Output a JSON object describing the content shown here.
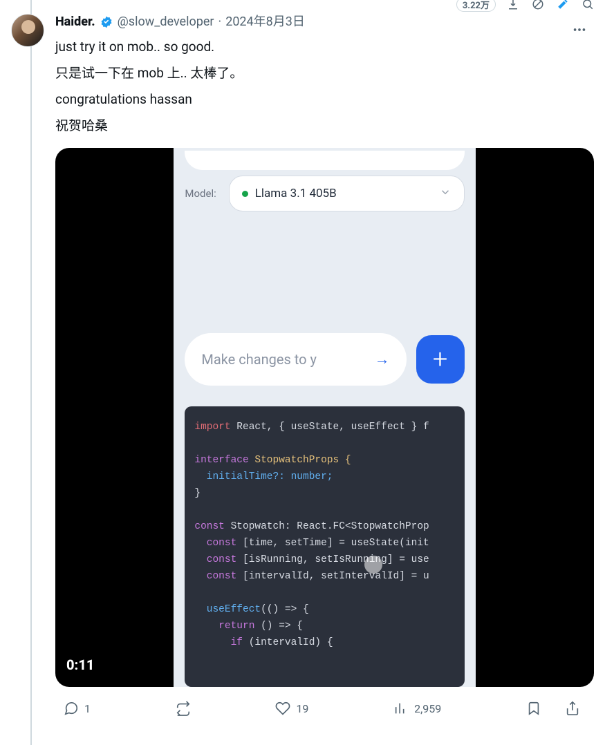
{
  "top": {
    "count_pill": "3.22万",
    "download_icon": "download-icon",
    "no_icon": "no-symbol-icon",
    "highlight_icon": "highlighter-icon",
    "search_icon": "search-icon"
  },
  "tweet": {
    "display_name": "Haider.",
    "handle": "@slow_developer",
    "dot": "·",
    "date": "2024年8月3日",
    "line1": "just try it on mob.. so good.",
    "line2": "只是试一下在 mob 上.. 太棒了。",
    "line3": "congratulations hassan",
    "line4": "祝贺哈桑"
  },
  "media": {
    "video_time": "0:11",
    "model_label": "Model:",
    "model_name": "Llama 3.1 405B",
    "input_placeholder": "Make changes to y",
    "code": {
      "l1_import": "import",
      "l1_rest": " React, { useState, useEffect } f",
      "l3_kw": "interface",
      "l3_name": " StopwatchProps {",
      "l4": "  initialTime?: number;",
      "l5": "}",
      "l7_kw": "const",
      "l7_rest": " Stopwatch: React.FC<StopwatchProp",
      "l8_kw": "  const",
      "l8_rest": " [time, setTime] = useState(init",
      "l9_kw": "  const",
      "l9_rest": " [isRunning, setIsRunning] = use",
      "l10_kw": "  const",
      "l10_rest": " [intervalId, setIntervalId] = u",
      "l12_fn": "  useEffect",
      "l12_rest": "(() => {",
      "l13_kw": "    return",
      "l13_rest": " () => {",
      "l14_kw": "      if",
      "l14_rest": " (intervalId) {"
    }
  },
  "actions": {
    "replies": "1",
    "likes": "19",
    "views": "2,959"
  }
}
